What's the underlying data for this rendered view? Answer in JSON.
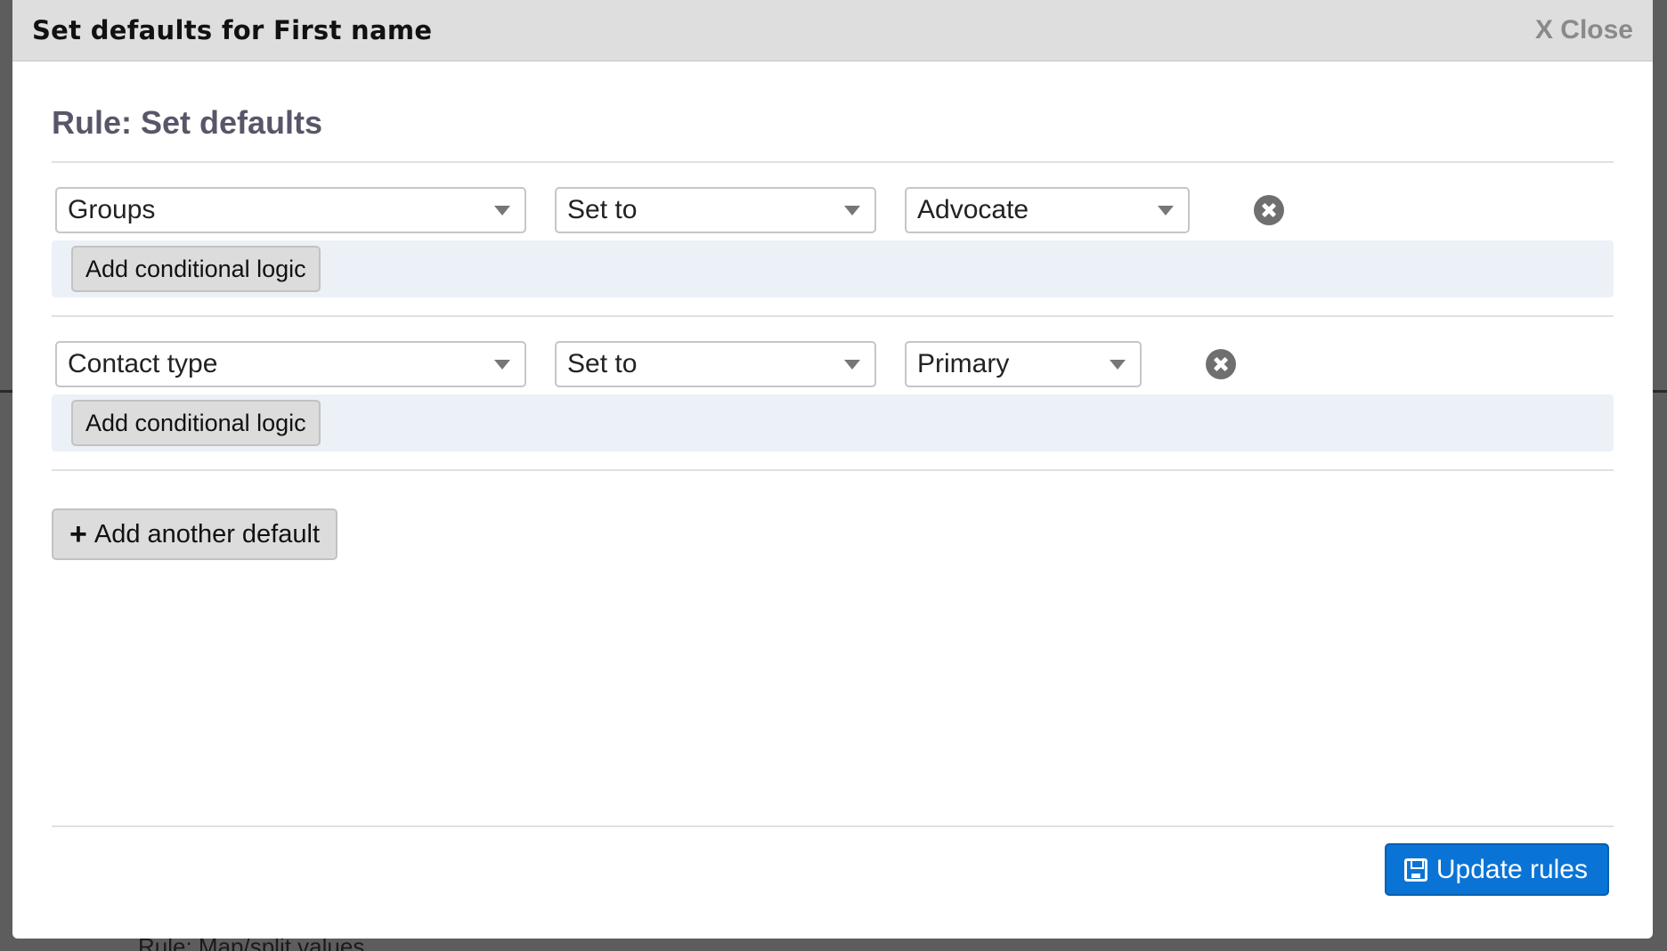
{
  "modal": {
    "title": "Set defaults for First name",
    "close_label": "X Close",
    "rule_heading": "Rule: Set defaults",
    "defaults": [
      {
        "field": "Groups",
        "operator": "Set to",
        "value": "Advocate",
        "conditional_label": "Add conditional logic"
      },
      {
        "field": "Contact type",
        "operator": "Set to",
        "value": "Primary",
        "conditional_label": "Add conditional logic"
      }
    ],
    "add_default_label": "Add another default",
    "update_label": "Update rules"
  },
  "background": {
    "fragment_text": "Rule: Map/split values"
  },
  "colors": {
    "primary_button": "#0a74d6",
    "header_bg": "#dedede",
    "conditional_bg": "#ecf1f8"
  }
}
